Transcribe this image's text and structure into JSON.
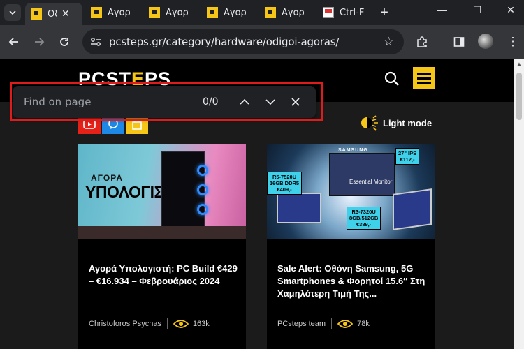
{
  "browser": {
    "tabs": [
      {
        "label": "Οδ",
        "active": true
      },
      {
        "label": "Αγορά"
      },
      {
        "label": "Αγορά"
      },
      {
        "label": "Αγορά"
      },
      {
        "label": "Αγορά"
      },
      {
        "label": "Ctrl-F"
      }
    ],
    "new_tab": "+",
    "url": "pcsteps.gr/category/hardware/odigoi-agoras/"
  },
  "find_bar": {
    "placeholder": "Find on page",
    "count": "0/0"
  },
  "site": {
    "logo_left": "PCST",
    "logo_e": "E",
    "logo_right": "PS",
    "light_mode_label": "Light mode"
  },
  "cards": [
    {
      "thumb_text_top": "ΑΓΟΡΑ",
      "thumb_text_main": "ΥΠΟΛΟΓΙΣΤΗ",
      "title": "Αγορά Υπολογιστή: PC Build €429 – €16.934 – Φεβρουάριος 2024",
      "author": "Christoforos Psychas",
      "views": "163k"
    },
    {
      "brand": "SAMSUNG",
      "monitor_label": "Essential Monitor",
      "price_tags": [
        "27\" IPS\n€112,-",
        "R5-7520U\n16GB DDR5\n€409,-",
        "R3-7320U\n8GB/512GB\n€389,-"
      ],
      "title": "Sale Alert: Οθόνη Samsung, 5G Smartphones & Φορητοί 15.6″ Στη Χαμηλότερη Τιμή Της...",
      "author": "PCsteps team",
      "views": "78k"
    }
  ],
  "colors": {
    "accent": "#f5c518",
    "highlight": "#e01b1b",
    "youtube": "#e62117",
    "blue": "#1e88e5"
  }
}
